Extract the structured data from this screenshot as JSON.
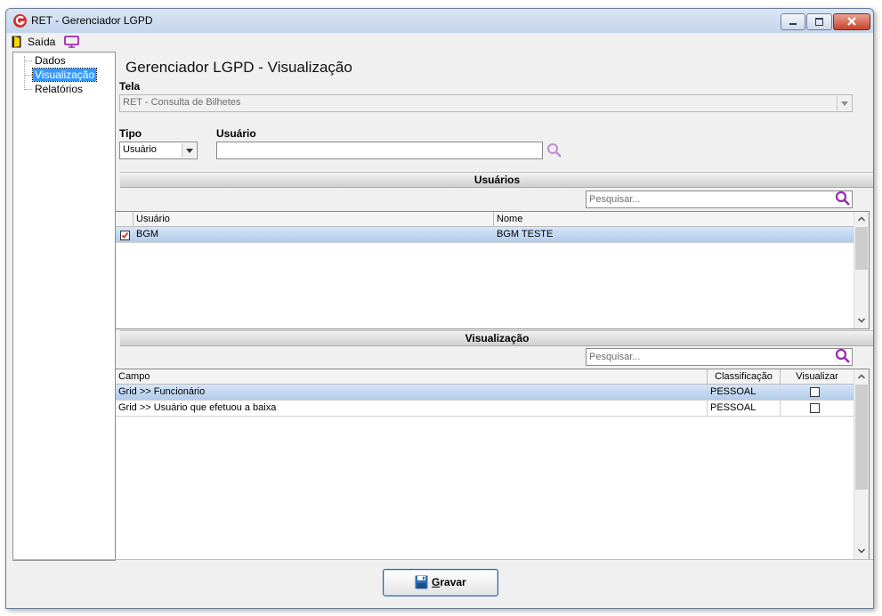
{
  "window": {
    "title": "RET - Gerenciador LGPD"
  },
  "toolbar": {
    "exit_label": "Saída"
  },
  "sidebar": {
    "items": [
      {
        "label": "Dados"
      },
      {
        "label": "Visualização",
        "selected": true
      },
      {
        "label": "Relatórios"
      }
    ]
  },
  "page": {
    "title": "Gerenciador LGPD - Visualização"
  },
  "form": {
    "tela_label": "Tela",
    "tela_value": "RET - Consulta de Bilhetes",
    "tipo_label": "Tipo",
    "tipo_value": "Usuário",
    "usuario_label": "Usuário",
    "usuario_value": ""
  },
  "usuarios": {
    "header": "Usuários",
    "search_placeholder": "Pesquisar...",
    "columns": [
      "Usuário",
      "Nome"
    ],
    "rows": [
      {
        "checked": true,
        "usuario": "BGM",
        "nome": "BGM TESTE",
        "selected": true
      }
    ]
  },
  "visualizacao": {
    "header": "Visualização",
    "search_placeholder": "Pesquisar...",
    "columns": [
      "Campo",
      "Classificação",
      "Visualizar"
    ],
    "rows": [
      {
        "campo": "Grid >> Funcionário",
        "classificacao": "PESSOAL",
        "visualizar": false,
        "selected": true
      },
      {
        "campo": "Grid >> Usuário que efetuou a baixa",
        "classificacao": "PESSOAL",
        "visualizar": false,
        "selected": false
      }
    ]
  },
  "footer": {
    "save_label_first": "G",
    "save_label_rest": "ravar"
  },
  "colors": {
    "accent_purple": "#9c27b0",
    "selection_blue": "#b2cbea",
    "tree_selected": "#3399ff",
    "close_red": "#c7432a"
  },
  "icons": {
    "app": "app-logo-icon",
    "exit": "exit-door-icon",
    "monitor": "monitor-icon",
    "search": "magnifier-icon",
    "save": "floppy-disk-icon"
  }
}
